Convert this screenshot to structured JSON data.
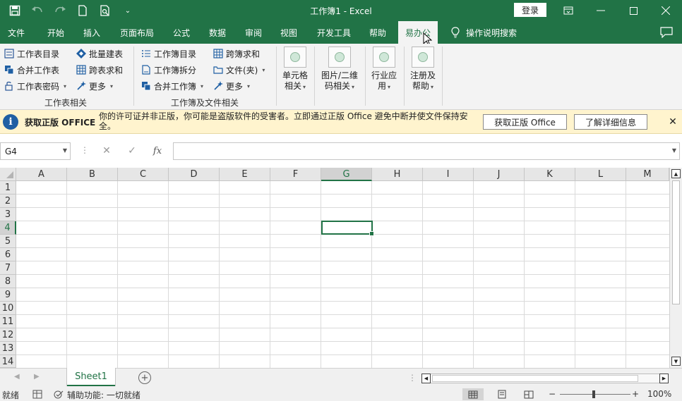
{
  "title_bar": {
    "title": "工作簿1  -  Excel",
    "login_label": "登录",
    "qat_more": "⌄"
  },
  "tabs": [
    {
      "label": "文件"
    },
    {
      "label": "开始"
    },
    {
      "label": "插入"
    },
    {
      "label": "页面布局"
    },
    {
      "label": "公式"
    },
    {
      "label": "数据"
    },
    {
      "label": "审阅"
    },
    {
      "label": "视图"
    },
    {
      "label": "开发工具"
    },
    {
      "label": "帮助"
    },
    {
      "label": "易办公"
    }
  ],
  "tell_me": "操作说明搜索",
  "ribbon": {
    "group1": {
      "label": "工作表相关",
      "items": [
        {
          "label": "工作表目录"
        },
        {
          "label": "合并工作表"
        },
        {
          "label": "工作表密码"
        },
        {
          "label": "批量建表"
        },
        {
          "label": "跨表求和"
        },
        {
          "label": "更多"
        }
      ]
    },
    "group2": {
      "label": "工作簿及文件相关",
      "items": [
        {
          "label": "工作簿目录"
        },
        {
          "label": "工作簿拆分"
        },
        {
          "label": "合并工作簿"
        },
        {
          "label": "跨簿求和"
        },
        {
          "label": "文件(夹)"
        },
        {
          "label": "更多"
        }
      ]
    },
    "big_buttons": [
      {
        "line1": "单元格",
        "line2": "相关"
      },
      {
        "line1": "图片/二维",
        "line2": "码相关"
      },
      {
        "line1": "行业应",
        "line2": "用"
      },
      {
        "line1": "注册及",
        "line2": "帮助"
      }
    ]
  },
  "message_bar": {
    "title": "获取正版 OFFICE",
    "text": "你的许可证并非正版，你可能是盗版软件的受害者。立即通过正版 Office 避免中断并使文件保持安全。",
    "btn_genuine": "获取正版 Office",
    "btn_learn": "了解详细信息"
  },
  "formula_bar": {
    "name_box": "G4",
    "fx": "fx",
    "formula": ""
  },
  "grid": {
    "columns": [
      "A",
      "B",
      "C",
      "D",
      "E",
      "F",
      "G",
      "H",
      "I",
      "J",
      "K",
      "L",
      "M"
    ],
    "rows": [
      "1",
      "2",
      "3",
      "4",
      "5",
      "6",
      "7",
      "8",
      "9",
      "10",
      "11",
      "12",
      "13",
      "14"
    ],
    "selected_column": "G",
    "selected_row": "4"
  },
  "sheets": [
    {
      "label": "Sheet1"
    }
  ],
  "status_bar": {
    "ready": "就绪",
    "accessibility": "辅助功能: 一切就绪",
    "zoom_minus": "−",
    "zoom_plus": "+",
    "zoom": "100%"
  },
  "colors": {
    "accent": "#217346",
    "message_bg": "#fff4ce"
  }
}
